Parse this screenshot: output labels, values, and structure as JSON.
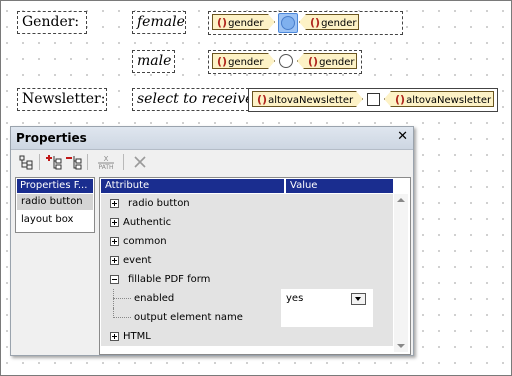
{
  "design": {
    "gender_label": "Gender:",
    "female_label": "female",
    "male_label": "male",
    "newsletter_label": "Newsletter:",
    "select_label": "select to receive",
    "tag_gender": "gender",
    "tag_newsletter": "altovaNewsletter"
  },
  "properties": {
    "title": "Properties",
    "close_glyph": "✕",
    "toolbar_path_label": "PATH",
    "left_header": "Properties F...",
    "left_items": [
      "radio button",
      "layout box"
    ],
    "columns": {
      "attribute": "Attribute",
      "value": "Value"
    },
    "rows": [
      {
        "label": "radio button"
      },
      {
        "label": "Authentic"
      },
      {
        "label": "common"
      },
      {
        "label": "event"
      },
      {
        "label": "fillable PDF form"
      },
      {
        "label": "enabled",
        "value": "yes"
      },
      {
        "label": "output element name",
        "value": ""
      },
      {
        "label": "HTML"
      }
    ]
  }
}
